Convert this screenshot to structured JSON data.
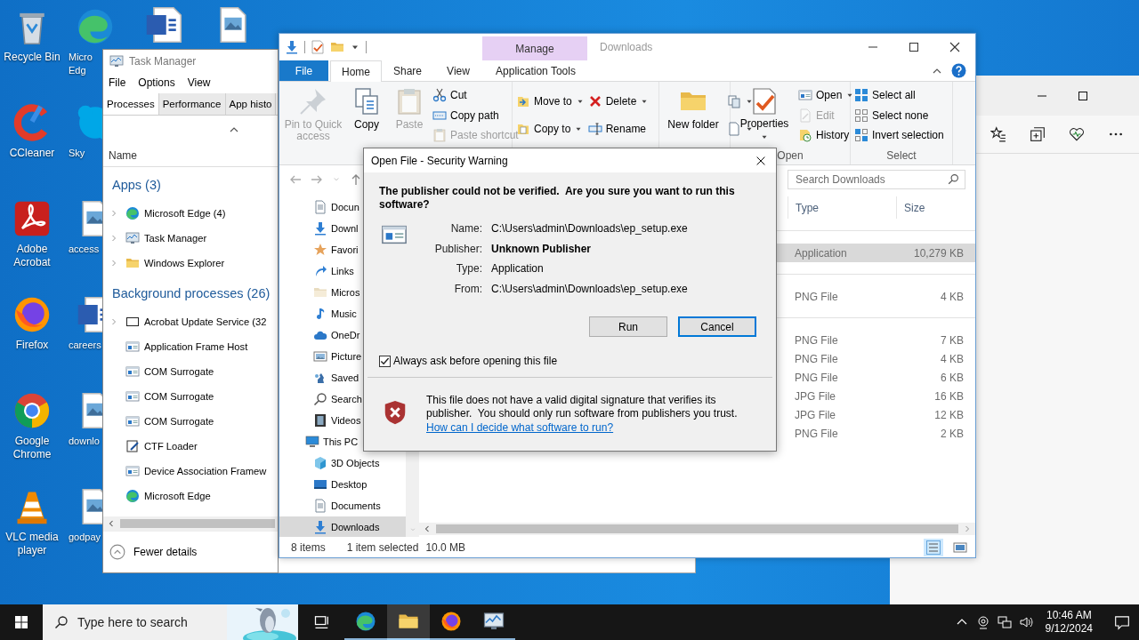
{
  "desktop": {
    "column_1": [
      {
        "label": "Recycle Bin"
      },
      {
        "label": "CCleaner"
      },
      {
        "label": "Adobe Acrobat"
      },
      {
        "label": "Firefox"
      },
      {
        "label": "Google Chrome"
      },
      {
        "label": "VLC media player"
      }
    ],
    "column_2": [
      {
        "label": "Micro Edg"
      },
      {
        "label": "Sky"
      },
      {
        "label": "access"
      },
      {
        "label": "careers"
      },
      {
        "label": "downlo"
      },
      {
        "label": "godpay"
      }
    ]
  },
  "task_manager": {
    "title": "Task Manager",
    "menu": [
      "File",
      "Options",
      "View"
    ],
    "tabs": [
      {
        "label": "Processes",
        "selected": true
      },
      {
        "label": "Performance",
        "selected": false
      },
      {
        "label": "App histo",
        "selected": false
      }
    ],
    "column": "Name",
    "groups": [
      {
        "title": "Apps (3)",
        "processes": [
          {
            "name": "Microsoft Edge (4)",
            "expandable": true
          },
          {
            "name": "Task Manager",
            "expandable": true
          },
          {
            "name": "Windows Explorer",
            "expandable": true
          }
        ]
      },
      {
        "title": "Background processes (26)",
        "processes": [
          {
            "name": "Acrobat Update Service (32",
            "expandable": true
          },
          {
            "name": "Application Frame Host",
            "expandable": false
          },
          {
            "name": "COM Surrogate",
            "expandable": false
          },
          {
            "name": "COM Surrogate",
            "expandable": false
          },
          {
            "name": "COM Surrogate",
            "expandable": false
          },
          {
            "name": "CTF Loader",
            "expandable": false
          },
          {
            "name": "Device Association Framew",
            "expandable": false
          },
          {
            "name": "Microsoft Edge",
            "expandable": false
          }
        ]
      }
    ],
    "footer": "Fewer details"
  },
  "explorer": {
    "manage": "Manage",
    "title": "Downloads",
    "tabs": [
      {
        "label": "File",
        "kind": "file",
        "selected": false
      },
      {
        "label": "Home",
        "kind": "tab",
        "selected": true
      },
      {
        "label": "Share",
        "kind": "tab",
        "selected": false
      },
      {
        "label": "View",
        "kind": "tab",
        "selected": false
      },
      {
        "label": "Application Tools",
        "kind": "context",
        "selected": false
      }
    ],
    "ribbon": [
      {
        "columns": [
          {
            "kind": "large",
            "items": [
              {
                "label": "Pin to Quick access",
                "disabled": true,
                "dropdown": false
              }
            ]
          },
          {
            "kind": "large",
            "items": [
              {
                "label": "Copy",
                "disabled": false,
                "dropdown": false
              }
            ]
          },
          {
            "kind": "large",
            "items": [
              {
                "label": "Paste",
                "disabled": true,
                "dropdown": false
              }
            ]
          },
          {
            "kind": "small",
            "items": [
              {
                "label": "Cut",
                "disabled": false,
                "dropdown": false
              },
              {
                "label": "Copy path",
                "disabled": false,
                "dropdown": false
              },
              {
                "label": "Paste shortcut",
                "disabled": true,
                "dropdown": false
              }
            ]
          }
        ]
      },
      {
        "columns": [
          {
            "kind": "small",
            "items": [
              {
                "label": "Move to",
                "disabled": false,
                "dropdown": true
              },
              {
                "label": "Copy to",
                "disabled": false,
                "dropdown": true
              }
            ]
          },
          {
            "kind": "small",
            "items": [
              {
                "label": "Delete",
                "disabled": false,
                "dropdown": true
              },
              {
                "label": "Rename",
                "disabled": false,
                "dropdown": false
              }
            ]
          }
        ]
      },
      {
        "columns": [
          {
            "kind": "large",
            "items": [
              {
                "label": "New folder",
                "disabled": false,
                "dropdown": false
              }
            ]
          },
          {
            "kind": "small",
            "items": [
              {
                "disabled": false,
                "dropdown": true
              },
              {
                "disabled": false,
                "dropdown": true
              }
            ]
          }
        ]
      },
      {
        "label": "Open",
        "columns": [
          {
            "kind": "large",
            "items": [
              {
                "label": "Properties",
                "disabled": false,
                "dropdown": true
              }
            ]
          },
          {
            "kind": "small",
            "items": [
              {
                "label": "Open",
                "disabled": false,
                "dropdown": true
              },
              {
                "label": "Edit",
                "disabled": true,
                "dropdown": false
              },
              {
                "label": "History",
                "disabled": false,
                "dropdown": false
              }
            ]
          }
        ]
      },
      {
        "label": "Select",
        "columns": [
          {
            "kind": "small",
            "items": [
              {
                "label": "Select all",
                "disabled": false,
                "dropdown": false
              },
              {
                "label": "Select none",
                "disabled": false,
                "dropdown": false
              },
              {
                "label": "Invert selection",
                "disabled": false,
                "dropdown": false
              }
            ]
          }
        ]
      }
    ],
    "search_placeholder": "Search Downloads",
    "nav": [
      {
        "label": "Docun",
        "selected": false
      },
      {
        "label": "Downl",
        "selected": false
      },
      {
        "label": "Favori",
        "selected": false
      },
      {
        "label": "Links",
        "selected": false
      },
      {
        "label": "Micros",
        "selected": false
      },
      {
        "label": "Music",
        "selected": false
      },
      {
        "label": "OneDr",
        "selected": false
      },
      {
        "label": "Picture",
        "selected": false
      },
      {
        "label": "Saved",
        "selected": false
      },
      {
        "label": "Search",
        "selected": false
      },
      {
        "label": "Videos",
        "selected": false
      },
      {
        "label": "This PC",
        "selected": false,
        "children": [
          {
            "label": "3D Objects",
            "selected": false
          },
          {
            "label": "Desktop",
            "selected": false
          },
          {
            "label": "Documents",
            "selected": false
          },
          {
            "label": "Downloads",
            "selected": true
          }
        ]
      }
    ],
    "columns": [
      "Type",
      "Size"
    ],
    "groups": [
      {
        "rows": [
          {
            "type": "Application",
            "size": "10,279 KB",
            "selected": true
          }
        ]
      },
      {
        "rows": [
          {
            "type": "PNG File",
            "size": "4 KB",
            "selected": false
          }
        ]
      },
      {
        "rows": [
          {
            "type": "PNG File",
            "size": "7 KB",
            "selected": false
          },
          {
            "type": "PNG File",
            "size": "4 KB",
            "selected": false
          },
          {
            "type": "PNG File",
            "size": "6 KB",
            "selected": false
          },
          {
            "type": "JPG File",
            "size": "16 KB",
            "selected": false
          },
          {
            "type": "JPG File",
            "size": "12 KB",
            "selected": false
          },
          {
            "type": "PNG File",
            "size": "2 KB",
            "selected": false
          }
        ]
      }
    ],
    "status": {
      "items": "8 items",
      "selection": "1 item selected",
      "size": "10.0 MB",
      "views": [
        {
          "selected": true
        },
        {
          "selected": false
        }
      ]
    }
  },
  "dialog": {
    "title": "Open File - Security Warning",
    "question": "The publisher could not be verified.  Are you sure you want to run this software?",
    "fields": [
      {
        "label": "Name:",
        "value": "C:\\Users\\admin\\Downloads\\ep_setup.exe",
        "bold": false
      },
      {
        "label": "Publisher:",
        "value": "Unknown Publisher",
        "bold": true
      },
      {
        "label": "Type:",
        "value": "Application",
        "bold": false
      },
      {
        "label": "From:",
        "value": "C:\\Users\\admin\\Downloads\\ep_setup.exe",
        "bold": false
      }
    ],
    "buttons": [
      {
        "label": "Run",
        "default": false
      },
      {
        "label": "Cancel",
        "default": true
      }
    ],
    "always_ask": {
      "label": "Always ask before opening this file",
      "checked": true
    },
    "notice": "This file does not have a valid digital signature that verifies its publisher.  You should only run software from publishers you trust.",
    "link": "How can I decide what software to run?"
  },
  "taskbar": {
    "search_placeholder": "Type here to search",
    "apps": [
      {
        "selected": false
      },
      {
        "selected": true
      },
      {
        "selected": false
      },
      {
        "selected": false
      }
    ],
    "time": "10:46 AM",
    "date": "9/12/2024"
  }
}
